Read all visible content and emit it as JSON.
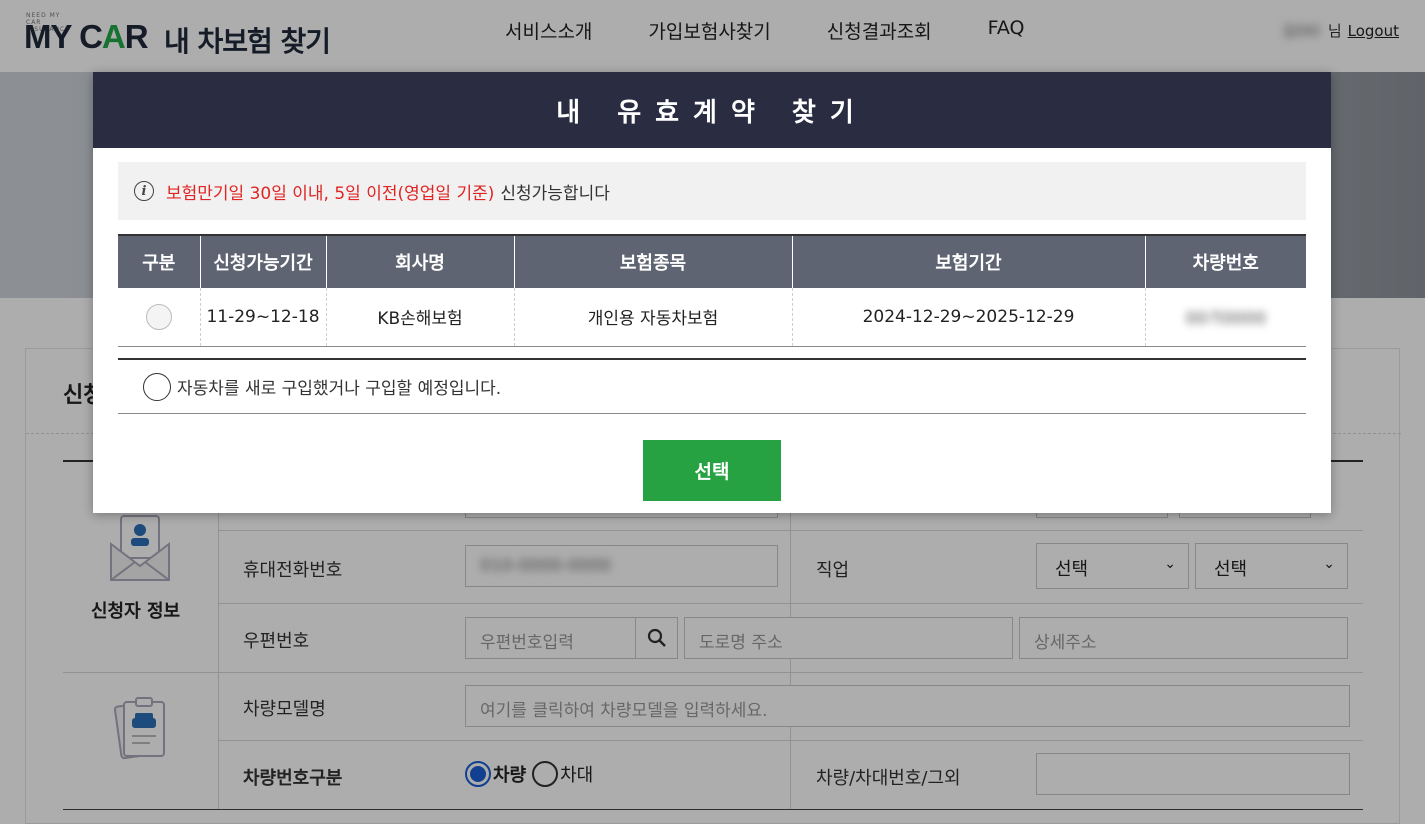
{
  "header": {
    "logo_small": "NEED MY CAR INSURANCE",
    "logo_my": "MY C",
    "logo_a": "A",
    "logo_r": "R",
    "logo_sub": "내 차보험 찾기",
    "nav": [
      "서비스소개",
      "가입보험사찾기",
      "신청결과조회",
      "FAQ"
    ],
    "user_name": "김OO",
    "user_suffix": "님",
    "logout": "Logout"
  },
  "form": {
    "title": "신청",
    "applicant_section": "신청자 정보",
    "phone_label": "휴대전화번호",
    "phone_value": "010-0000-0000",
    "job_label": "직업",
    "job_select_1": "선택",
    "job_select_2": "선택",
    "zip_label": "우편번호",
    "zip_placeholder": "우편번호입력",
    "road_placeholder": "도로명 주소",
    "detail_placeholder": "상세주소",
    "car_model_label": "차량모델명",
    "car_model_placeholder": "여기를 클릭하여 차량모델을 입력하세요.",
    "car_number_type_label": "차량번호구분",
    "car_number_type_options": [
      "차량",
      "차대"
    ],
    "car_number_label": "차량/차대번호/그외"
  },
  "modal": {
    "title": "내 유효계약 찾기",
    "notice_red": "보험만기일 30일 이내, 5일 이전(영업일 기준)",
    "notice_black": "신청가능합니다",
    "columns": [
      "구분",
      "신청가능기간",
      "회사명",
      "보험종목",
      "보험기간",
      "차량번호"
    ],
    "rows": [
      {
        "period": "11-29~12-18",
        "company": "KB손해보험",
        "product": "개인용 자동차보험",
        "term": "2024-12-29~2025-12-29",
        "car_number": "00가0000"
      }
    ],
    "newcar_label": "자동차를 새로 구입했거나 구입할 예정입니다.",
    "select_button": "선택"
  },
  "colors": {
    "modal_header": "#2a2d42",
    "table_header": "#5f6472",
    "notice_red": "#e02424",
    "select_button": "#27a243",
    "logo_accent": "#22a84a"
  }
}
